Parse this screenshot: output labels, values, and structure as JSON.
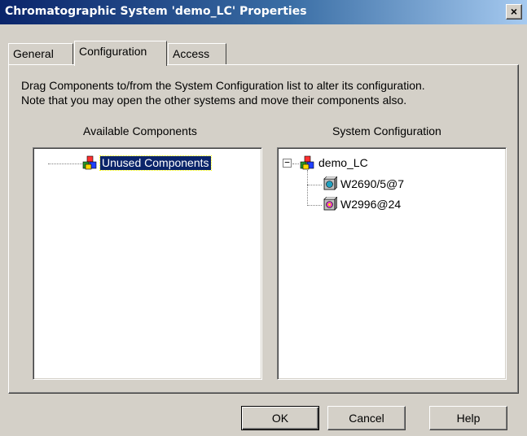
{
  "window": {
    "title": "Chromatographic System 'demo_LC' Properties",
    "close_label": "×"
  },
  "tabs": [
    {
      "label": "General",
      "active": false
    },
    {
      "label": "Configuration",
      "active": true
    },
    {
      "label": "Access",
      "active": false
    }
  ],
  "instructions": {
    "line1": "Drag Components to/from the System Configuration list to alter its configuration.",
    "line2": "Note that you may open the other systems and move their components also."
  },
  "available": {
    "label": "Available Components",
    "items": [
      {
        "label": "Unused Components",
        "icon": "components-group-icon",
        "selected": true
      }
    ]
  },
  "system": {
    "label": "System Configuration",
    "root": {
      "label": "demo_LC",
      "icon": "system-group-icon",
      "expanded": true,
      "expander": "−"
    },
    "children": [
      {
        "label": "W2690/5@7",
        "icon": "pump-module-icon"
      },
      {
        "label": "W2996@24",
        "icon": "detector-module-icon"
      }
    ]
  },
  "buttons": {
    "ok": "OK",
    "cancel": "Cancel",
    "help": "Help"
  },
  "colors": {
    "titlebar_start": "#0a246a",
    "titlebar_end": "#a6caf0",
    "dialog_face": "#d4d0c8",
    "selection": "#0a246a"
  }
}
